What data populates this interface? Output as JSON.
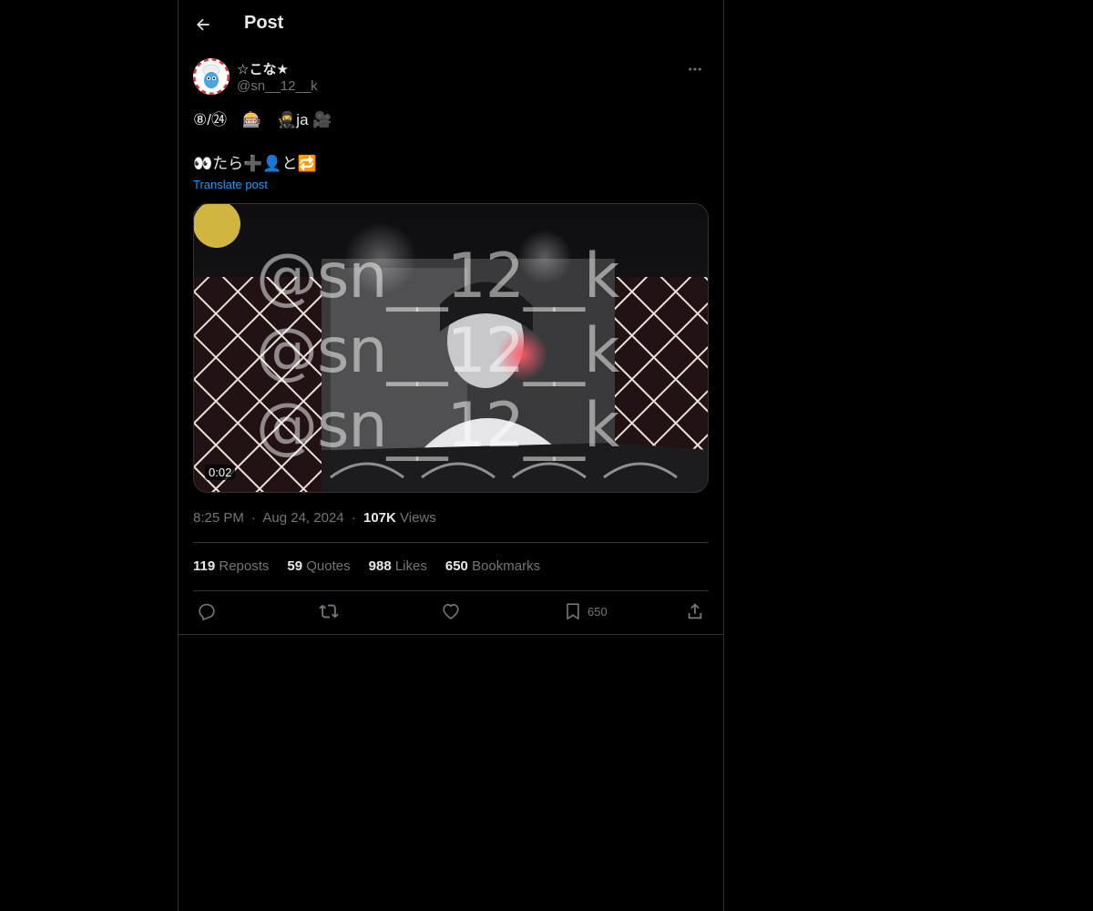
{
  "header": {
    "title": "Post"
  },
  "author": {
    "display_name": "☆こな★",
    "handle": "@sn__12__k"
  },
  "post": {
    "text": "⑧/㉔　🎰　🥷ja 🎥\n\n👀たら➕👤と🔁",
    "translate_label": "Translate post"
  },
  "media": {
    "duration": "0:02",
    "watermark": "@sn__12__k"
  },
  "meta": {
    "time": "8:25 PM",
    "date": "Aug 24, 2024",
    "views_count": "107K",
    "views_label": "Views",
    "separator": "·"
  },
  "stats": {
    "reposts_count": "119",
    "reposts_label": "Reposts",
    "quotes_count": "59",
    "quotes_label": "Quotes",
    "likes_count": "988",
    "likes_label": "Likes",
    "bookmarks_count": "650",
    "bookmarks_label": "Bookmarks"
  },
  "actions": {
    "bookmark_count": "650"
  },
  "icons": {
    "back": "arrow-left-icon",
    "more": "more-horizontal-icon",
    "reply": "reply-icon",
    "repost": "repost-icon",
    "like": "heart-icon",
    "bookmark": "bookmark-icon",
    "share": "share-icon"
  },
  "colors": {
    "background": "#000000",
    "text": "#e7e9ea",
    "muted": "#71767b",
    "accent": "#1d9bf0",
    "border": "#2f3336"
  }
}
